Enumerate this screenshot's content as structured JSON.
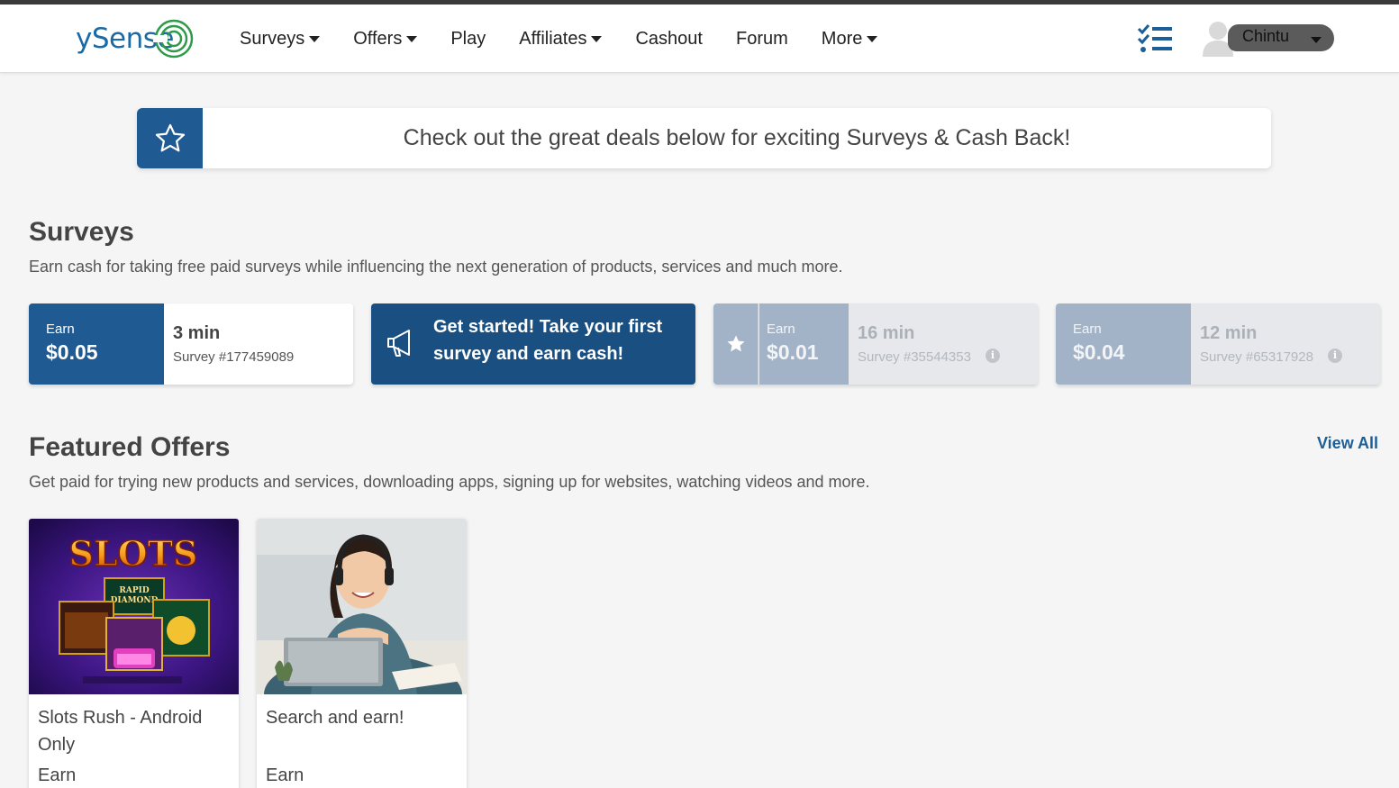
{
  "header": {
    "logo": "ySense",
    "nav": [
      {
        "label": "Surveys",
        "dropdown": true
      },
      {
        "label": "Offers",
        "dropdown": true
      },
      {
        "label": "Play",
        "dropdown": false
      },
      {
        "label": "Affiliates",
        "dropdown": true
      },
      {
        "label": "Cashout",
        "dropdown": false
      },
      {
        "label": "Forum",
        "dropdown": false
      },
      {
        "label": "More",
        "dropdown": true
      }
    ],
    "tasks_icon": "checklist-icon",
    "user": {
      "name": "Chintu",
      "avatar_icon": "user-avatar-icon"
    }
  },
  "banner": {
    "icon": "star-outline-icon",
    "text": "Check out the great deals below for exciting Surveys & Cash Back!"
  },
  "surveys": {
    "title": "Surveys",
    "subtitle": "Earn cash for taking free paid surveys while influencing the next generation of products, services and much more.",
    "cards": [
      {
        "earn_label": "Earn",
        "amount": "$0.05",
        "time": "3 min",
        "survey_id": "Survey #177459089",
        "state": "active"
      },
      {
        "promo_text": "Get started! Take your first survey and earn cash!",
        "icon": "megaphone-icon",
        "state": "promo"
      },
      {
        "earn_label": "Earn",
        "amount": "$0.01",
        "time": "16 min",
        "survey_id": "Survey #35544353",
        "state": "locked"
      },
      {
        "earn_label": "Earn",
        "amount": "$0.04",
        "time": "12 min",
        "survey_id": "Survey #65317928",
        "state": "locked"
      }
    ]
  },
  "offers": {
    "title": "Featured Offers",
    "subtitle": "Get paid for trying new products and services, downloading apps, signing up for websites, watching videos and more.",
    "view_all": "View All",
    "items": [
      {
        "title": "Slots Rush - Android Only",
        "earn_label": "Earn",
        "image_text": "SLOTS"
      },
      {
        "title": "Search and earn!",
        "earn_label": "Earn"
      }
    ]
  },
  "colors": {
    "brand_blue": "#1f5a92",
    "promo_blue": "#1a4f82",
    "locked_blue": "#a3b3c7",
    "link_blue": "#1c5f98"
  }
}
